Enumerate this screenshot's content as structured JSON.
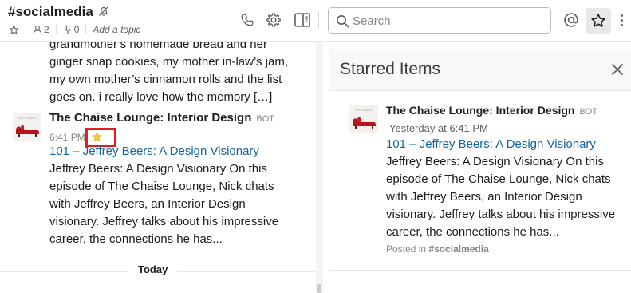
{
  "channel": {
    "name": "#socialmedia",
    "members": "2",
    "pins": "0",
    "add_topic": "Add a topic"
  },
  "search": {
    "placeholder": "Search"
  },
  "messages": {
    "continuation": "grandmother’s homemade bread and her ginger snap cookies, my mother in-law’s jam, my own mother’s cinnamon rolls and the list goes on. i really love how the memory […]",
    "post": {
      "author": "The Chaise Lounge: Interior Design",
      "badge": "BOT",
      "time": "6:41 PM",
      "link_title": "101 – Jeffrey Beers: A Design Visionary",
      "body": "Jeffrey Beers: A Design Visionary On this episode of The Chaise Lounge, Nick chats with Jeffrey Beers, an Interior Design visionary. Jeffrey talks about his impressive career, the connections he has..."
    },
    "day_divider": "Today"
  },
  "starred_panel": {
    "title": "Starred Items",
    "item": {
      "author": "The Chaise Lounge: Interior Design",
      "badge": "BOT",
      "time": "Yesterday at 6:41 PM",
      "link_title": "101 – Jeffrey Beers: A Design Visionary",
      "body": "Jeffrey Beers: A Design Visionary On this episode of The Chaise Lounge, Nick chats with Jeffrey Beers, an Interior Design visionary. Jeffrey talks about his impressive career, the connections he has...",
      "posted_in_prefix": "Posted in",
      "posted_in_channel": "#socialmedia"
    }
  },
  "icons": {
    "mute": "bell-slash-icon",
    "star": "star-icon",
    "members": "person-icon",
    "pins": "pin-icon",
    "call": "phone-icon",
    "settings": "gear-icon",
    "details": "sidebar-panel-icon",
    "search": "search-icon",
    "mentions": "at-sign-icon",
    "starred": "star-outline-icon",
    "more": "vertical-dots-icon",
    "close": "close-icon",
    "avatar": "red-chaise-lounge-icon"
  },
  "colors": {
    "link": "#1264a3",
    "highlight_box": "#e01e1e",
    "star_filled": "#f2c744",
    "muted_text": "#868686",
    "panel_header_bg": "#f8f8f8"
  }
}
